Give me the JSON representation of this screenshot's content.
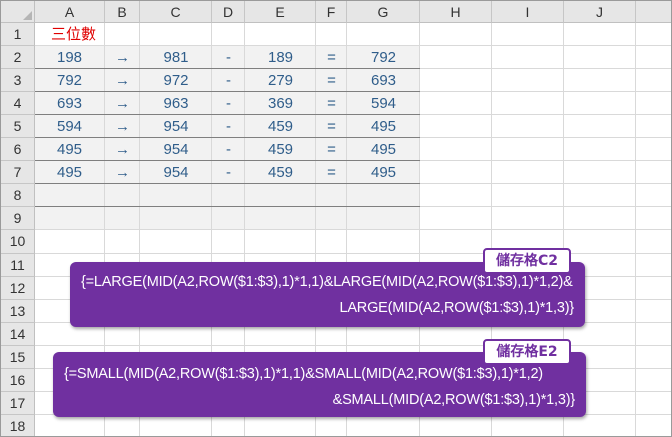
{
  "columns": [
    "A",
    "B",
    "C",
    "D",
    "E",
    "F",
    "G",
    "H",
    "I",
    "J"
  ],
  "rows": [
    "1",
    "2",
    "3",
    "4",
    "5",
    "6",
    "7",
    "8",
    "9",
    "10",
    "11",
    "12",
    "13",
    "14",
    "15",
    "16",
    "17",
    "18"
  ],
  "title": "三位數",
  "table": [
    [
      "198",
      "→",
      "981",
      "-",
      "189",
      "=",
      "792"
    ],
    [
      "792",
      "→",
      "972",
      "-",
      "279",
      "=",
      "693"
    ],
    [
      "693",
      "→",
      "963",
      "-",
      "369",
      "=",
      "594"
    ],
    [
      "594",
      "→",
      "954",
      "-",
      "459",
      "=",
      "495"
    ],
    [
      "495",
      "→",
      "954",
      "-",
      "459",
      "=",
      "495"
    ],
    [
      "495",
      "→",
      "954",
      "-",
      "459",
      "=",
      "495"
    ]
  ],
  "callout_c2": {
    "tag": "儲存格C2",
    "line1": "{=LARGE(MID(A2,ROW($1:$3),1)*1,1)&LARGE(MID(A2,ROW($1:$3),1)*1,2)&",
    "line2": "LARGE(MID(A2,ROW($1:$3),1)*1,3)}"
  },
  "callout_e2": {
    "tag": "儲存格E2",
    "line1": "{=SMALL(MID(A2,ROW($1:$3),1)*1,1)&SMALL(MID(A2,ROW($1:$3),1)*1,2)",
    "line2": "&SMALL(MID(A2,ROW($1:$3),1)*1,3)}"
  },
  "colors": {
    "callout": "#7030a0",
    "title": "#e00000",
    "values": "#2f5d8a"
  }
}
